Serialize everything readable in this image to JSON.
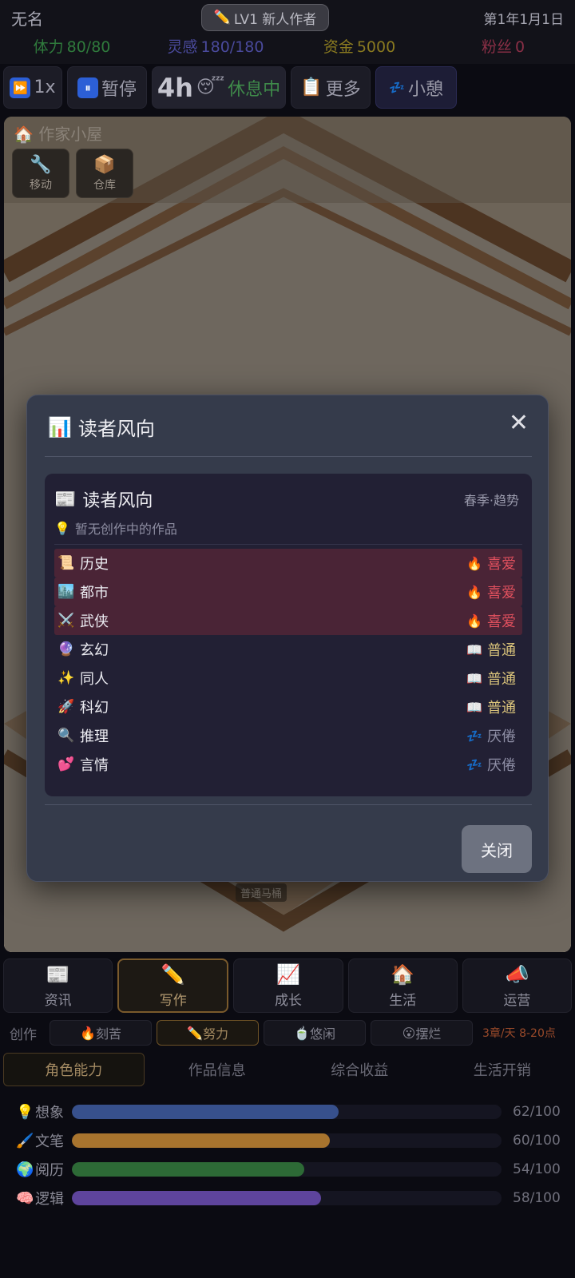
{
  "player": {
    "name": "无名",
    "level": "LV1 新人作者",
    "date": "第1年1月1日"
  },
  "stats": [
    {
      "label": "体力",
      "value": "80/80",
      "color": "#2f7a3c"
    },
    {
      "label": "灵感",
      "value": "180/180",
      "color": "#4a4a9c"
    },
    {
      "label": "资金",
      "value": "5000",
      "color": "#8a7a20"
    },
    {
      "label": "粉丝",
      "value": "0",
      "color": "#8a2f46"
    }
  ],
  "toolbar": {
    "speed": "1x",
    "pause": "暂停",
    "rest_hours": "4h",
    "rest_status": "休息中",
    "more": "更多",
    "nap": "小憩"
  },
  "scene": {
    "title": "作家小屋",
    "move": "移动",
    "storage": "仓库",
    "object_label": "普通马桶"
  },
  "modal": {
    "title": "读者风向",
    "close_label": "关闭",
    "panel_title": "读者风向",
    "season": "春季·趋势",
    "hint": "暂无创作中的作品",
    "genres": [
      {
        "icon": "scroll-icon",
        "name": "历史",
        "status": "喜爱",
        "status_icon": "fire-icon",
        "hot": true
      },
      {
        "icon": "city-icon",
        "name": "都市",
        "status": "喜爱",
        "status_icon": "fire-icon",
        "hot": true
      },
      {
        "icon": "swords-icon",
        "name": "武侠",
        "status": "喜爱",
        "status_icon": "fire-icon",
        "hot": true
      },
      {
        "icon": "crystal-ball-icon",
        "name": "玄幻",
        "status": "普通",
        "status_icon": "book-icon",
        "hot": false
      },
      {
        "icon": "sparkles-icon",
        "name": "同人",
        "status": "普通",
        "status_icon": "book-icon",
        "hot": false
      },
      {
        "icon": "rocket-icon",
        "name": "科幻",
        "status": "普通",
        "status_icon": "book-icon",
        "hot": false
      },
      {
        "icon": "magnifier-icon",
        "name": "推理",
        "status": "厌倦",
        "status_icon": "sleep-icon",
        "hot": false
      },
      {
        "icon": "hearts-icon",
        "name": "言情",
        "status": "厌倦",
        "status_icon": "sleep-icon",
        "hot": false
      }
    ]
  },
  "nav": [
    {
      "label": "资讯",
      "icon": "newspaper-icon",
      "active": false
    },
    {
      "label": "写作",
      "icon": "pencil-icon",
      "active": true
    },
    {
      "label": "成长",
      "icon": "chart-icon",
      "active": false
    },
    {
      "label": "生活",
      "icon": "house-icon",
      "active": false
    },
    {
      "label": "运营",
      "icon": "megaphone-icon",
      "active": false
    }
  ],
  "modes": {
    "label": "创作",
    "options": [
      {
        "label": "刻苦",
        "active": false
      },
      {
        "label": "努力",
        "active": true
      },
      {
        "label": "悠闲",
        "active": false
      },
      {
        "label": "摆烂",
        "active": false
      }
    ],
    "rate": "3章/天 8-20点"
  },
  "info_tabs": [
    {
      "label": "角色能力",
      "active": true
    },
    {
      "label": "作品信息",
      "active": false
    },
    {
      "label": "综合收益",
      "active": false
    },
    {
      "label": "生活开销",
      "active": false
    }
  ],
  "abilities": [
    {
      "name": "想象",
      "value": 62,
      "max": 100,
      "display": "62/100",
      "color": "#37508c",
      "icon": "bulb-icon"
    },
    {
      "name": "文笔",
      "value": 60,
      "max": 100,
      "display": "60/100",
      "color": "#a8742e",
      "icon": "brush-icon"
    },
    {
      "name": "阅历",
      "value": 54,
      "max": 100,
      "display": "54/100",
      "color": "#2d6a36",
      "icon": "globe-icon"
    },
    {
      "name": "逻辑",
      "value": 58,
      "max": 100,
      "display": "58/100",
      "color": "#5e449c",
      "icon": "brain-icon"
    }
  ],
  "colors": {
    "hot": "#e0505e",
    "normal": "#d8c27a",
    "bored": "#8f8fa6"
  }
}
